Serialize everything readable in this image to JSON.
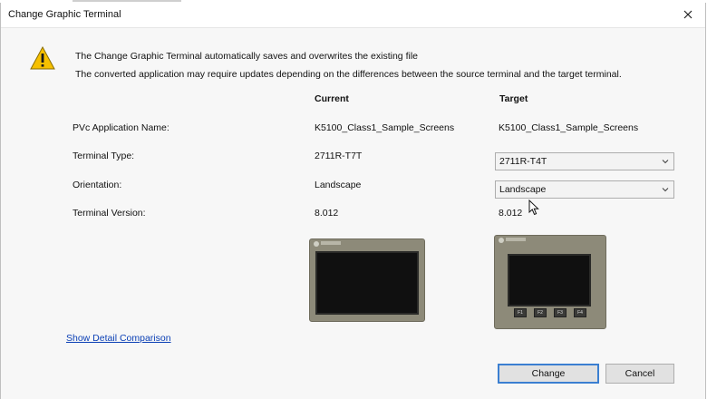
{
  "dialog": {
    "title": "Change Graphic Terminal",
    "messages": [
      "The Change Graphic Terminal automatically saves and overwrites the existing file",
      "The converted application may require updates depending on the differences between the source terminal and the target terminal."
    ]
  },
  "columns": {
    "current": "Current",
    "target": "Target"
  },
  "rows": {
    "app_name": {
      "label": "PVc Application Name:",
      "current": "K5100_Class1_Sample_Screens",
      "target": "K5100_Class1_Sample_Screens"
    },
    "terminal_type": {
      "label": "Terminal Type:",
      "current": "2711R-T7T",
      "target": "2711R-T4T"
    },
    "orientation": {
      "label": "Orientation:",
      "current": "Landscape",
      "target": "Landscape"
    },
    "version": {
      "label": "Terminal Version:",
      "current": "8.012",
      "target": "8.012"
    }
  },
  "target_keys": [
    "F1",
    "F2",
    "F3",
    "F4"
  ],
  "link": {
    "show_detail": "Show Detail Comparison"
  },
  "buttons": {
    "change": "Change",
    "cancel": "Cancel"
  },
  "icons": {
    "warning": "warning-icon",
    "close": "close-icon",
    "dropdown": "chevron-down-icon"
  },
  "colors": {
    "warning": "#f6c000",
    "link": "#0a3fb5",
    "focus": "#3b7fd1"
  }
}
